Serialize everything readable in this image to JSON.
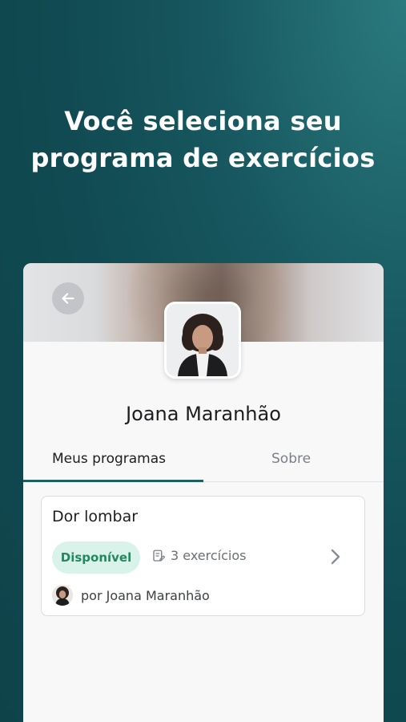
{
  "headline": {
    "line1": "Você seleciona seu",
    "line2": "programa de exercícios"
  },
  "profile": {
    "name": "Joana Maranhão"
  },
  "tabs": [
    {
      "label": "Meus programas",
      "active": true
    },
    {
      "label": "Sobre",
      "active": false
    }
  ],
  "program": {
    "title": "Dor lombar",
    "status": "Disponível",
    "exercise_count": "3 exercícios",
    "author": "por Joana Maranhão"
  },
  "colors": {
    "accent": "#1f5f6a",
    "badge_bg": "#daf3ea",
    "badge_text": "#21885f"
  }
}
